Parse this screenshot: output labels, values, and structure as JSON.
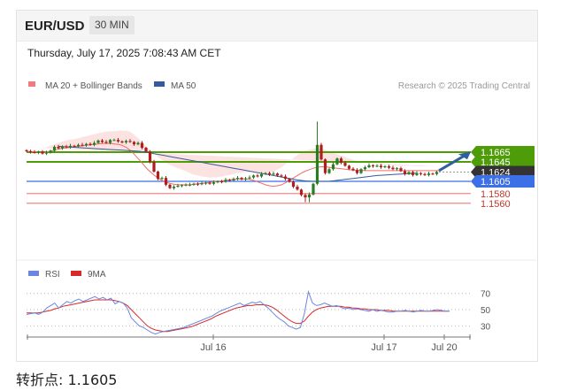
{
  "header": {
    "symbol": "EUR/USD",
    "timeframe": "30 MIN",
    "datetime": "Thursday, July 17, 2025 7:08:43 AM CET",
    "credit": "Research © 2025 Trading Central"
  },
  "pivot": {
    "label": "转折点:",
    "value": "1.1605"
  },
  "colors": {
    "resistance": "#4f9c09",
    "pivot": "#3d6fe6",
    "support": "#ef8a8a",
    "current": "#333333",
    "bollinger": "#f36a6a",
    "ma50": "#345c9b",
    "candle_up": "#2a7d24",
    "candle_down": "#b01d1d",
    "rsi": "#6c86e0",
    "rsi_ma": "#d42a2a",
    "arrow": "#2f5f9c"
  },
  "chart_data": [
    {
      "type": "candlestick",
      "legend": [
        {
          "name": "MA 20 + Bollinger Bands",
          "color": "#f07d7d"
        },
        {
          "name": "MA 50",
          "color": "#345c9b"
        }
      ],
      "x_ticks": [
        "Jul 16",
        "Jul 17",
        "Jul 20"
      ],
      "ylim": [
        1.1555,
        1.1735
      ],
      "levels": [
        {
          "value": 1.1665,
          "label": "1.1665",
          "kind": "resistance"
        },
        {
          "value": 1.1645,
          "label": "1.1645",
          "kind": "resistance"
        },
        {
          "value": 1.1624,
          "label": "1.1624",
          "kind": "current"
        },
        {
          "value": 1.1605,
          "label": "1.1605",
          "kind": "pivot"
        },
        {
          "value": 1.158,
          "label": "1.1580",
          "kind": "support"
        },
        {
          "value": 1.156,
          "label": "1.1560",
          "kind": "support"
        }
      ],
      "close": [
        1.1667,
        1.1665,
        1.1664,
        1.1666,
        1.1662,
        1.1664,
        1.1668,
        1.1676,
        1.1673,
        1.1677,
        1.1675,
        1.1678,
        1.1677,
        1.168,
        1.1679,
        1.1682,
        1.168,
        1.1684,
        1.1689,
        1.1686,
        1.1684,
        1.169,
        1.169,
        1.1687,
        1.1685,
        1.1688,
        1.1686,
        1.1681,
        1.1684,
        1.1674,
        1.1666,
        1.1645,
        1.1625,
        1.161,
        1.1612,
        1.1598,
        1.1591,
        1.1594,
        1.1596,
        1.1597,
        1.1598,
        1.1598,
        1.16,
        1.1599,
        1.1601,
        1.1602,
        1.16,
        1.1603,
        1.1605,
        1.1604,
        1.1608,
        1.1607,
        1.161,
        1.1612,
        1.1609,
        1.1611,
        1.1613,
        1.1617,
        1.1615,
        1.162,
        1.1622,
        1.1619,
        1.1621,
        1.1617,
        1.1615,
        1.161,
        1.1604,
        1.1594,
        1.1588,
        1.1577,
        1.1572,
        1.1578,
        1.16,
        1.168,
        1.165,
        1.1622,
        1.163,
        1.164,
        1.1652,
        1.1643,
        1.1637,
        1.1631,
        1.1628,
        1.1622,
        1.163,
        1.1634,
        1.1638,
        1.1636,
        1.1637,
        1.1634,
        1.1636,
        1.1633,
        1.163,
        1.1632,
        1.1626,
        1.162,
        1.1624,
        1.1618,
        1.1622,
        1.162,
        1.1618,
        1.1621,
        1.162,
        1.1624
      ],
      "ma20": [
        1.1667,
        1.1666,
        1.1666,
        1.1665,
        1.1664,
        1.1665,
        1.1667,
        1.1669,
        1.1671,
        1.1673,
        1.1674,
        1.1675,
        1.1676,
        1.1677,
        1.1678,
        1.1679,
        1.168,
        1.1681,
        1.1682,
        1.1683,
        1.1683,
        1.1683,
        1.1682,
        1.1681,
        1.1679,
        1.1675,
        1.1669,
        1.1661,
        1.1652,
        1.1643,
        1.1633,
        1.1625,
        1.1618,
        1.1612,
        1.1607,
        1.1603,
        1.1601,
        1.1599,
        1.1598,
        1.1598,
        1.1598,
        1.1598,
        1.1599,
        1.16,
        1.1601,
        1.1602,
        1.1603,
        1.1604,
        1.1605,
        1.1606,
        1.1607,
        1.1608,
        1.1609,
        1.161,
        1.161,
        1.161,
        1.1609,
        1.1607,
        1.1604,
        1.1601,
        1.1598,
        1.1596,
        1.1595,
        1.1596,
        1.1598,
        1.1602,
        1.1607,
        1.1612,
        1.1617,
        1.1622,
        1.1626,
        1.1629,
        1.1632,
        1.1634,
        1.1635,
        1.1635,
        1.1634,
        1.1633,
        1.1632,
        1.1631,
        1.163,
        1.1629,
        1.1628,
        1.1628,
        1.1628,
        1.1627,
        1.1627,
        1.1627,
        1.1627,
        1.1627,
        1.1627,
        1.1627,
        1.1627,
        1.1627,
        1.1627,
        1.1627,
        1.1627,
        1.1627,
        1.1627,
        1.1627,
        1.1627,
        1.1627,
        1.1627,
        1.1627,
        1.1627
      ],
      "bb_width": [
        0.0008,
        0.0008,
        0.0009,
        0.0009,
        0.001,
        0.001,
        0.0011,
        0.0012,
        0.0013,
        0.0014,
        0.0015,
        0.0016,
        0.0016,
        0.0017,
        0.0018,
        0.0019,
        0.002,
        0.0021,
        0.0022,
        0.0023,
        0.0024,
        0.0025,
        0.0026,
        0.0028,
        0.003,
        0.0034,
        0.0038,
        0.004,
        0.0042,
        0.0043,
        0.0044,
        0.0044,
        0.0044,
        0.0043,
        0.0042,
        0.004,
        0.0038,
        0.0036,
        0.0034,
        0.0031,
        0.0028,
        0.0024,
        0.002,
        0.0017,
        0.0014,
        0.0012,
        0.001,
        0.0009,
        0.0009,
        0.0009,
        0.001,
        0.001,
        0.0011,
        0.0012,
        0.0013,
        0.0014,
        0.0015,
        0.0017,
        0.0019,
        0.0021,
        0.0024,
        0.0027,
        0.003,
        0.0033,
        0.0036,
        0.0038,
        0.004,
        0.0041,
        0.0042,
        0.0042,
        0.0042,
        0.0041,
        0.004,
        0.0039,
        0.0037,
        0.0035,
        0.0033,
        0.0031,
        0.0029,
        0.0027,
        0.0025,
        0.0023,
        0.0021,
        0.0019,
        0.0017,
        0.0016,
        0.0015,
        0.0014,
        0.0013,
        0.0012,
        0.0012,
        0.0011,
        0.0011,
        0.001,
        0.001,
        0.001,
        0.001,
        0.001,
        0.0009,
        0.0009,
        0.0009,
        0.0009,
        0.0009,
        0.0009
      ],
      "ma50": [
        1.1677,
        1.1676,
        1.1675,
        1.1674,
        1.1673,
        1.1672,
        1.1671,
        1.167,
        1.1669,
        1.1668,
        1.1667,
        1.1665,
        1.1662,
        1.1659,
        1.1656,
        1.1653,
        1.165,
        1.1647,
        1.1644,
        1.1641,
        1.1638,
        1.1635,
        1.1632,
        1.1629,
        1.1626,
        1.1623,
        1.162,
        1.1617,
        1.1614,
        1.1611,
        1.1608,
        1.1606,
        1.1605,
        1.1605,
        1.1605,
        1.1607,
        1.1609,
        1.1611,
        1.1613,
        1.1615,
        1.1617,
        1.1618,
        1.1619,
        1.162,
        1.1621,
        1.1622
      ],
      "ma50_start": 8
    },
    {
      "type": "line",
      "legend": [
        {
          "name": "RSI",
          "color": "#6c86e0"
        },
        {
          "name": "9MA",
          "color": "#d42a2a"
        }
      ],
      "ylim": [
        20,
        80
      ],
      "levels": [
        70,
        50,
        30
      ],
      "rsi": [
        44,
        45,
        46,
        44,
        47,
        52,
        55,
        58,
        52,
        56,
        60,
        58,
        61,
        63,
        60,
        62,
        64,
        66,
        63,
        65,
        62,
        64,
        57,
        60,
        58,
        52,
        40,
        35,
        30,
        28,
        25,
        22,
        20,
        22,
        23,
        24,
        25,
        26,
        27,
        28,
        30,
        32,
        34,
        36,
        38,
        40,
        42,
        45,
        48,
        50,
        52,
        54,
        56,
        58,
        55,
        57,
        59,
        58,
        60,
        56,
        52,
        47,
        42,
        38,
        35,
        30,
        28,
        26,
        28,
        45,
        72,
        58,
        55,
        56,
        58,
        56,
        54,
        55,
        53,
        51,
        52,
        50,
        51,
        50,
        49,
        48,
        50,
        48,
        49,
        48,
        47,
        47,
        48,
        48,
        49,
        48,
        47,
        48,
        49,
        48,
        48,
        49,
        50,
        49,
        48,
        48
      ],
      "rsi_ma": [
        46,
        46,
        46,
        46,
        47,
        48,
        49,
        51,
        52,
        54,
        55,
        56,
        57,
        58,
        59,
        60,
        61,
        62,
        62,
        62,
        62,
        62,
        61,
        60,
        58,
        55,
        50,
        45,
        40,
        35,
        30,
        27,
        25,
        24,
        23,
        23,
        24,
        25,
        26,
        27,
        28,
        29,
        31,
        33,
        35,
        37,
        39,
        42,
        44,
        46,
        48,
        50,
        52,
        53,
        54,
        55,
        55,
        56,
        56,
        56,
        55,
        53,
        50,
        46,
        42,
        38,
        35,
        33,
        33,
        36,
        42,
        47,
        50,
        52,
        53,
        54,
        54,
        54,
        54,
        53,
        53,
        52,
        52,
        51,
        51,
        50,
        50,
        50,
        49,
        49,
        49,
        48,
        48,
        48,
        48,
        48,
        48,
        48,
        48,
        48,
        48,
        48,
        48,
        48,
        48,
        48
      ]
    }
  ]
}
